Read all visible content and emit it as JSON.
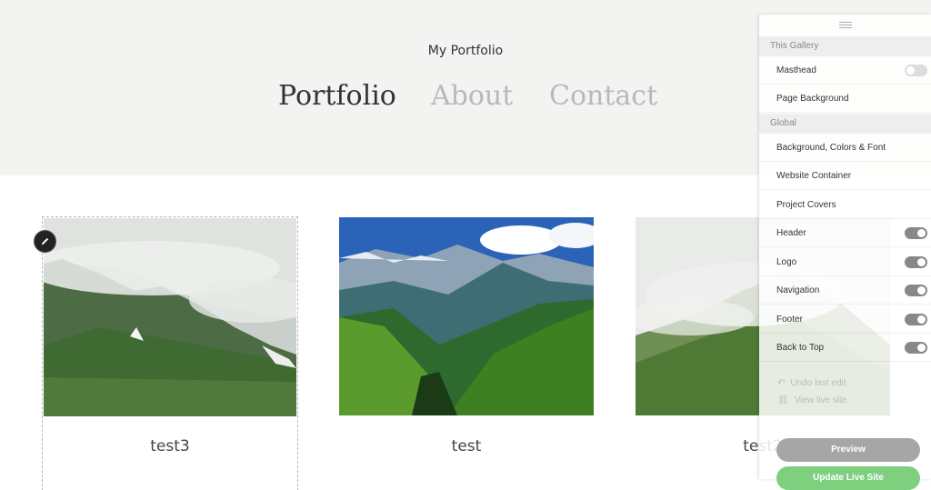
{
  "site": {
    "title": "My Portfolio"
  },
  "nav": {
    "portfolio": "Portfolio",
    "about": "About",
    "contact": "Contact"
  },
  "projects": [
    {
      "title": "test3"
    },
    {
      "title": "test"
    },
    {
      "title": "test2"
    }
  ],
  "panel": {
    "this_gallery": "This Gallery",
    "masthead": "Masthead",
    "page_background": "Page Background",
    "global": "Global",
    "background_colors_font": "Background, Colors & Font",
    "website_container": "Website Container",
    "project_covers": "Project Covers",
    "header": "Header",
    "logo": "Logo",
    "navigation": "Navigation",
    "footer": "Footer",
    "back_to_top": "Back to Top",
    "undo": "Undo last edit",
    "view_live": "View live site",
    "preview": "Preview",
    "update": "Update Live Site"
  },
  "toggles": {
    "masthead": false,
    "header": true,
    "logo": true,
    "navigation": true,
    "footer": true,
    "back_to_top": true
  },
  "icons": {
    "edit": "pencil-icon",
    "handle": "drag-handle-icon",
    "undo": "undo-icon",
    "view": "link-icon"
  },
  "colors": {
    "update_button": "#7ed07e",
    "preview_button": "#a6a6a6",
    "masthead_bg": "#f3f3f2"
  }
}
